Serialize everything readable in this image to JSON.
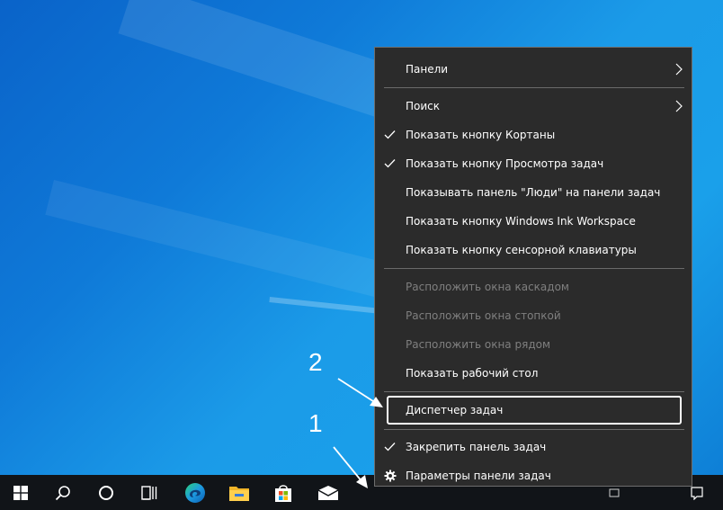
{
  "desktop": {
    "accent": "#0f7ad8"
  },
  "taskbar": {
    "icons": [
      "windows-start-icon",
      "search-icon",
      "cortana-circle-icon",
      "task-view-icon",
      "edge-icon",
      "file-explorer-icon",
      "store-icon",
      "mail-icon"
    ]
  },
  "menu": {
    "items": {
      "panels": "Панели",
      "search": "Поиск",
      "show_cortana": "Показать кнопку Кортаны",
      "show_task_view": "Показать кнопку Просмотра задач",
      "show_people": "Показывать панель \"Люди\" на панели задач",
      "show_ink": "Показать кнопку Windows Ink Workspace",
      "show_keyboard": "Показать кнопку сенсорной клавиатуры",
      "cascade": "Расположить окна каскадом",
      "stacked": "Расположить окна стопкой",
      "side_by_side": "Расположить окна рядом",
      "show_desktop": "Показать рабочий стол",
      "task_manager": "Диспетчер задач",
      "lock_taskbar": "Закрепить панель задач",
      "taskbar_settings": "Параметры панели задач"
    },
    "colors": {
      "background": "#2b2b2b",
      "text": "#ffffff",
      "disabled_text": "#7f7f7f"
    }
  },
  "callouts": {
    "one": "1",
    "two": "2"
  }
}
